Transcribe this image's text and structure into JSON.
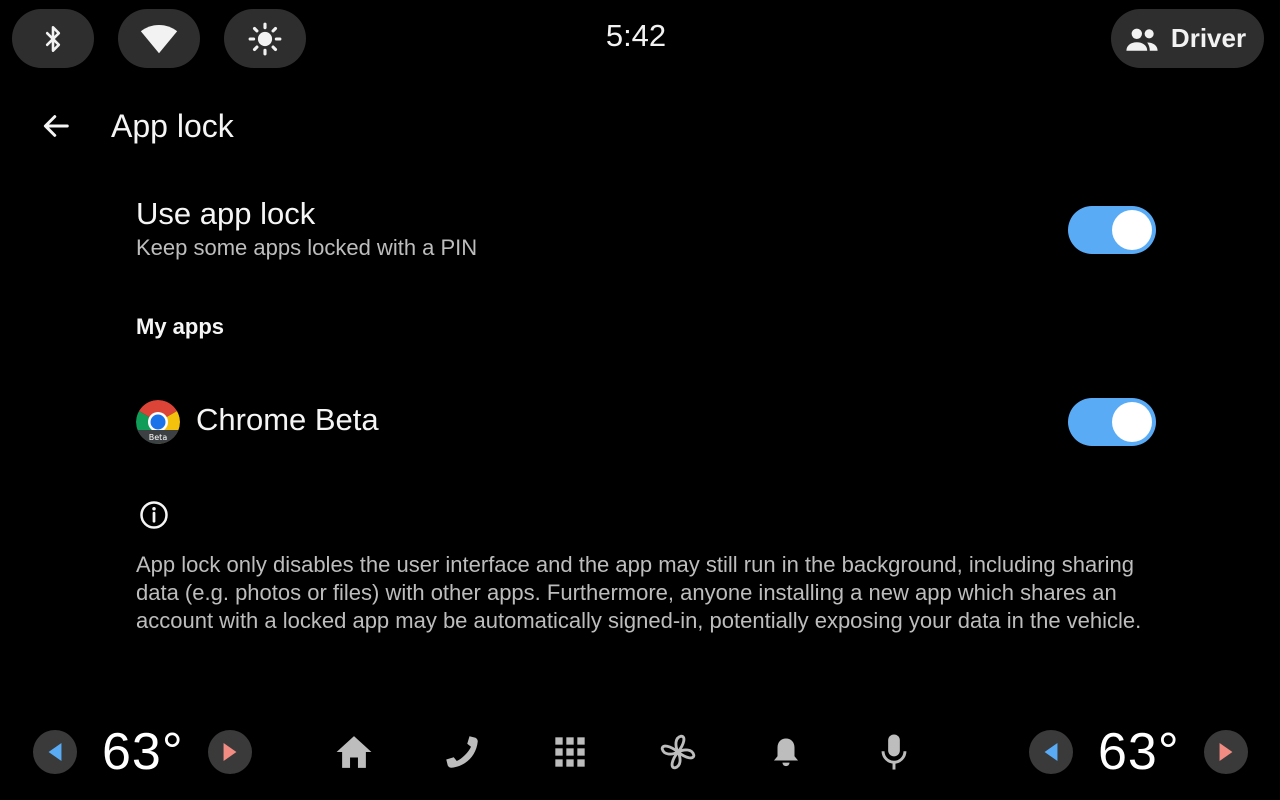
{
  "status_bar": {
    "clock": "5:42",
    "user_label": "Driver",
    "icons": [
      "bluetooth-icon",
      "wifi-icon",
      "brightness-icon",
      "people-icon"
    ]
  },
  "header": {
    "title": "App lock"
  },
  "use_app_lock": {
    "title": "Use app lock",
    "summary": "Keep some apps locked with a PIN",
    "enabled": true
  },
  "my_apps": {
    "category_title": "My apps",
    "apps": [
      {
        "name": "Chrome Beta",
        "icon_badge": "Beta",
        "locked": true
      }
    ]
  },
  "info": {
    "text": "App lock only disables the user interface and the app may still run in the background, including sharing data (e.g. photos or files) with other apps. Furthermore, anyone installing a new app which shares an account with a locked app may be automatically signed-in, potentially exposing your data in the vehicle."
  },
  "nav_bar": {
    "left_temp": "63°",
    "right_temp": "63°",
    "icons": [
      "home-icon",
      "phone-icon",
      "apps-grid-icon",
      "fan-icon",
      "notifications-icon",
      "microphone-icon"
    ]
  },
  "colors": {
    "switch_track": "#5aabf6",
    "pill_bg": "#2e2e2e",
    "arrow_left": "#5aabf6",
    "arrow_right": "#f28b82"
  }
}
